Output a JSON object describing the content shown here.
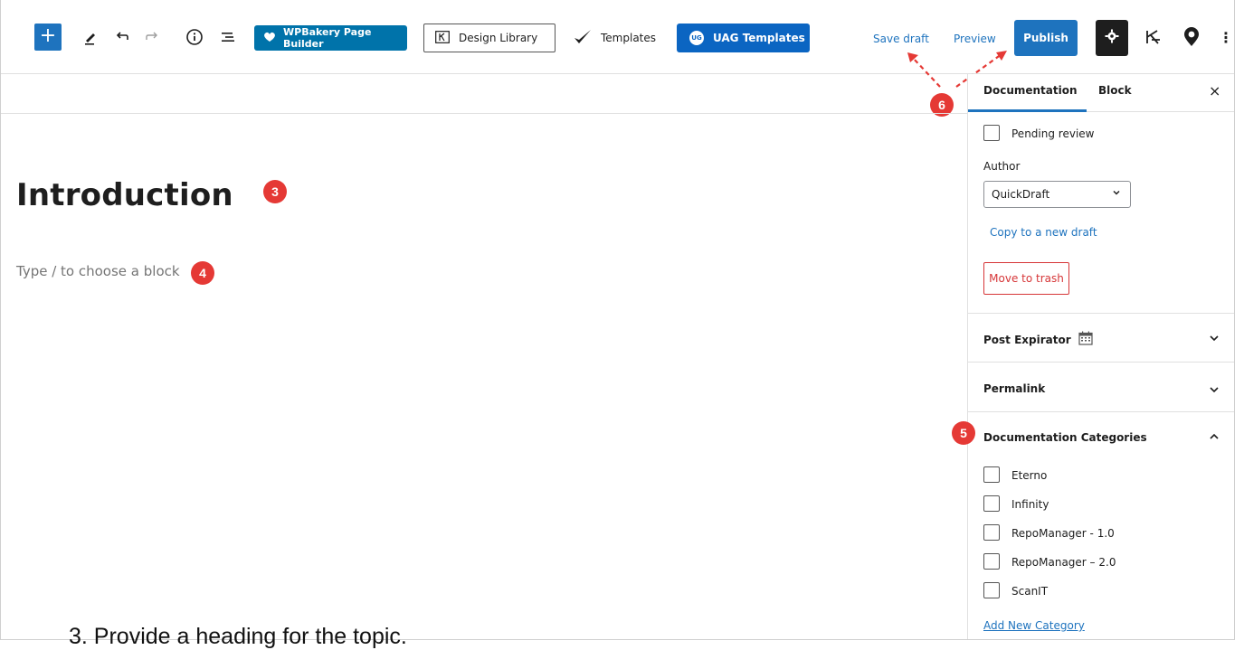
{
  "toolbar": {
    "add_label": "+",
    "wpbakery_label": "WPBakery Page Builder",
    "design_library_label": "Design Library",
    "templates_label": "Templates",
    "uag_templates_label": "UAG Templates",
    "uag_badge": "UG",
    "save_draft_label": "Save draft",
    "preview_label": "Preview",
    "publish_label": "Publish",
    "more_label": "⋮"
  },
  "editor": {
    "heading": "Introduction",
    "block_placeholder": "Type / to choose a block"
  },
  "sidebar": {
    "tabs": [
      {
        "label": "Documentation",
        "active": true
      },
      {
        "label": "Block",
        "active": false
      }
    ],
    "close_label": "×",
    "pending_review_label": "Pending review",
    "author_label": "Author",
    "author_value": "QuickDraft",
    "copy_draft_label": "Copy to a new draft",
    "move_trash_label": "Move to trash",
    "panels": [
      {
        "title": "Post Expirator",
        "expanded": false
      },
      {
        "title": "Permalink",
        "expanded": false
      },
      {
        "title": "Documentation Categories",
        "expanded": true
      }
    ],
    "categories": [
      "Eterno",
      "Infinity",
      "RepoManager - 1.0",
      "RepoManager – 2.0",
      "ScanIT"
    ],
    "add_category_label": "Add New Category"
  },
  "callouts": [
    "3",
    "4",
    "5",
    "6"
  ],
  "caption": "3. Provide a heading for the topic.",
  "colors": {
    "accent": "#1e73be",
    "callout": "#e53935",
    "trash": "#d63638",
    "uag": "#0b65c2"
  },
  "icons": [
    "plus-icon",
    "pencil-icon",
    "undo-icon",
    "redo-icon",
    "info-icon",
    "list-view-icon",
    "heart-icon",
    "design-library-icon",
    "templates-check-icon",
    "gear-icon",
    "kadence-icon",
    "location-pin-icon",
    "calendar-icon",
    "chevron-down-icon",
    "chevron-up-icon"
  ]
}
